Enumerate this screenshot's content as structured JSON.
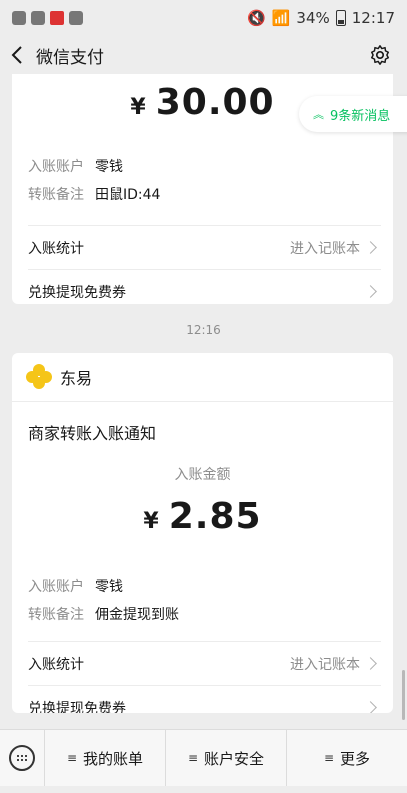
{
  "status": {
    "battery": "34%",
    "time": "12:17"
  },
  "nav": {
    "title": "微信支付"
  },
  "new_messages": "9条新消息",
  "card1": {
    "currency": "¥",
    "amount": "30.00",
    "rows": [
      {
        "label": "入账账户",
        "value": "零钱"
      },
      {
        "label": "转账备注",
        "value": "田鼠ID:44"
      }
    ],
    "stats_label": "入账统计",
    "stats_link": "进入记账本",
    "coupon_label": "兑换提现免费券"
  },
  "timestamp": "12:16",
  "card2": {
    "merchant": "东易",
    "title": "商家转账入账通知",
    "amount_label": "入账金额",
    "currency": "¥",
    "amount": "2.85",
    "rows": [
      {
        "label": "入账账户",
        "value": "零钱"
      },
      {
        "label": "转账备注",
        "value": "佣金提现到账"
      }
    ],
    "stats_label": "入账统计",
    "stats_link": "进入记账本",
    "coupon_label": "兑换提现免费券"
  },
  "bottom_menu": {
    "bill": "我的账单",
    "security": "账户安全",
    "more": "更多"
  },
  "colors": {
    "accent": "#07c160",
    "background": "#ededed"
  }
}
